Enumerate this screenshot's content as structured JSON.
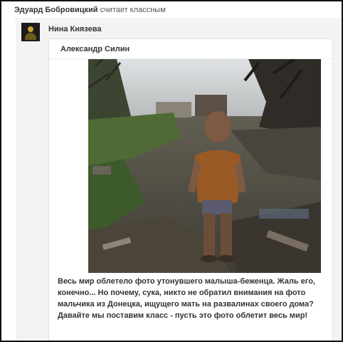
{
  "activity": {
    "actor": "Эдуард Бобровицкий",
    "action": "считает классным"
  },
  "share": {
    "author": "Нина Князева"
  },
  "post": {
    "author": "Александр Силин",
    "text": "Весь мир облетело фото утонувшего малыша-беженца. Жаль его, конечно... Но почему, сука, никто не обратил внимания на фото мальчика из Донецка, ищущего мать на развалинах своего дома?  Давайте мы поставим класс - пусть это фото облетит весь мир!"
  }
}
